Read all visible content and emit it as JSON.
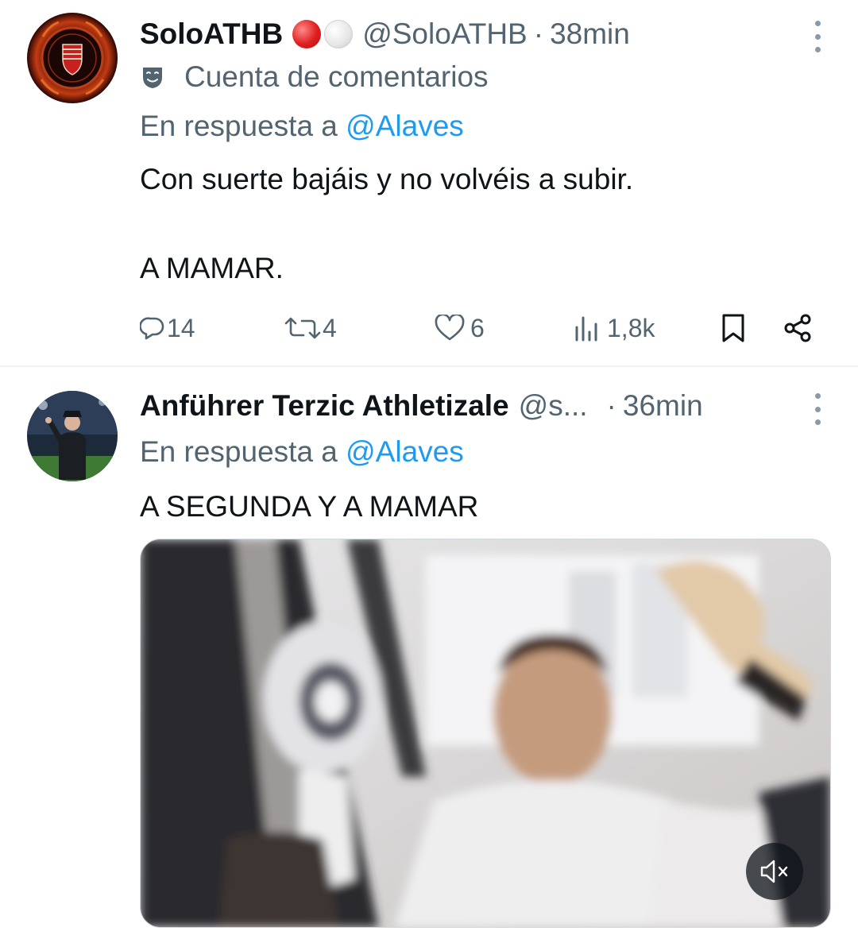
{
  "tweets": [
    {
      "display_name": "SoloATHB",
      "handle": "@SoloATHB",
      "separator": "·",
      "time": "38min",
      "badges": [
        "red-circle-emoji",
        "white-circle-emoji"
      ],
      "account_label": "Cuenta de comentarios",
      "reply_prefix": "En respuesta a",
      "reply_mention": "@Alaves",
      "text_lines": [
        "Con suerte bajáis y no volvéis a subir.",
        "A MAMAR."
      ],
      "actions": {
        "replies": "14",
        "reposts": "4",
        "likes": "6",
        "views": "1,8k"
      }
    },
    {
      "display_name": "Anführer Terzic Athletizale",
      "handle": "@s...",
      "separator": "·",
      "time": "36min",
      "reply_prefix": "En respuesta a",
      "reply_mention": "@Alaves",
      "text_lines": [
        "A SEGUNDA Y A MAMAR"
      ],
      "media": {
        "type": "video",
        "mute_icon": "speaker-muted-icon"
      }
    }
  ],
  "colors": {
    "text_primary": "#0f1419",
    "text_secondary": "#536471",
    "link": "#1d9bf0",
    "divider": "#eff3f4"
  }
}
